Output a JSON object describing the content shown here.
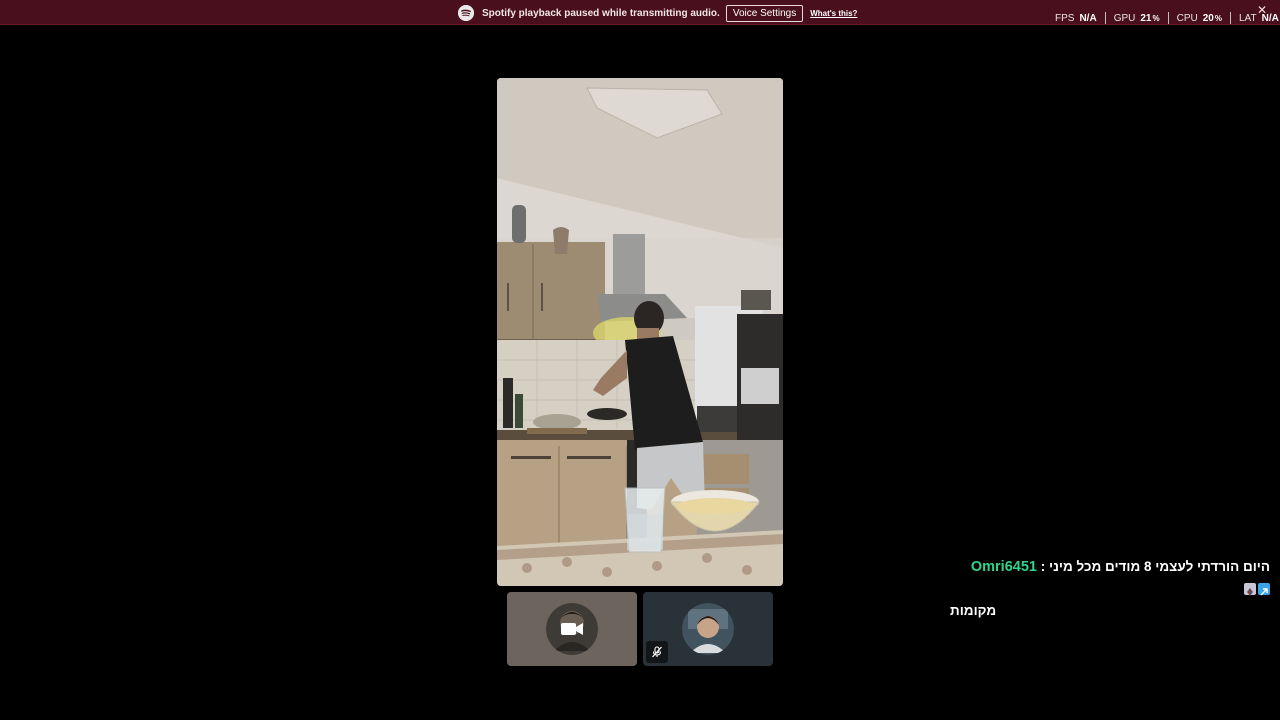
{
  "notice": {
    "text": "Spotify playback paused while transmitting audio.",
    "button_label": "Voice Settings",
    "link_label": "What's this?",
    "close_symbol": "✕",
    "icon": "spotify-icon",
    "bar_color": "#4a0f1d"
  },
  "perf": {
    "fps_label": "FPS",
    "fps_value": "N/A",
    "gpu_label": "GPU",
    "gpu_value": "21",
    "gpu_unit": "%",
    "cpu_label": "CPU",
    "cpu_value": "20",
    "cpu_unit": "%",
    "lat_label": "LAT",
    "lat_value": "N/A"
  },
  "participants": [
    {
      "icon": "camera-icon"
    },
    {
      "icon": "mic-muted-icon"
    }
  ],
  "chat": {
    "author": "Omri6451",
    "separator": ":",
    "message": "היום הורדתי לעצמי 8 מודים מכל מיני",
    "message_cont": "מקומות",
    "author_color": "#2ed58b"
  }
}
